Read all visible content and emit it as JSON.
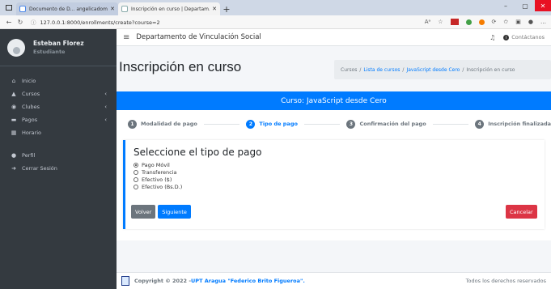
{
  "browser": {
    "tabs": [
      {
        "title": "Documento de D... angelicadom",
        "active": false
      },
      {
        "title": "Inscripción en curso | Departam...",
        "active": true
      }
    ],
    "url": "127.0.0.1:8000/enrollments/create?course=2"
  },
  "sidebar": {
    "user_name": "Esteban Florez",
    "user_role": "Estudiante",
    "items": [
      {
        "label": "Inicio",
        "icon": "home-icon",
        "glyph": "⌂",
        "chevron": false
      },
      {
        "label": "Cursos",
        "icon": "graduation-cap-icon",
        "glyph": "▲",
        "chevron": true
      },
      {
        "label": "Clubes",
        "icon": "basketball-icon",
        "glyph": "◉",
        "chevron": true
      },
      {
        "label": "Pagos",
        "icon": "money-icon",
        "glyph": "▬",
        "chevron": true
      },
      {
        "label": "Horario",
        "icon": "calendar-icon",
        "glyph": "▦",
        "chevron": false
      }
    ],
    "bottom_items": [
      {
        "label": "Perfil",
        "icon": "user-icon",
        "glyph": "●"
      },
      {
        "label": "Cerrar Sesión",
        "icon": "sign-out-icon",
        "glyph": "➜"
      }
    ]
  },
  "topnav": {
    "title": "Departamento de Vinculación Social",
    "contact": "Contáctanos"
  },
  "page": {
    "title": "Inscripción en curso",
    "breadcrumb": {
      "home": "Cursos",
      "list": "Lista de cursos",
      "course": "JavaScript desde Cero",
      "current": "Inscripción en curso"
    }
  },
  "card": {
    "header": "Curso: JavaScript desde Cero",
    "steps": [
      {
        "num": "1",
        "label": "Modalidad de pago",
        "active": false
      },
      {
        "num": "2",
        "label": "Tipo de pago",
        "active": true
      },
      {
        "num": "3",
        "label": "Confirmación del pago",
        "active": false
      },
      {
        "num": "4",
        "label": "Inscripción finalizada",
        "active": false
      }
    ],
    "form_title": "Seleccione el tipo de pago",
    "options": [
      {
        "label": "Pago Móvil",
        "checked": true
      },
      {
        "label": "Transferencia",
        "checked": false
      },
      {
        "label": "Efectivo ($)",
        "checked": false
      },
      {
        "label": "Efectivo (Bs.D.)",
        "checked": false
      }
    ],
    "back_label": "Volver",
    "next_label": "Siguiente",
    "cancel_label": "Cancelar"
  },
  "footer": {
    "copyright": "Copyright © 2022 - ",
    "institution": "UPT Aragua \"Federico Brito Figueroa\".",
    "rights": "Todos los derechos reservados"
  },
  "colors": {
    "primary": "#007bff",
    "danger": "#dc3545",
    "secondary": "#6c757d",
    "sidebar": "#343a40"
  }
}
